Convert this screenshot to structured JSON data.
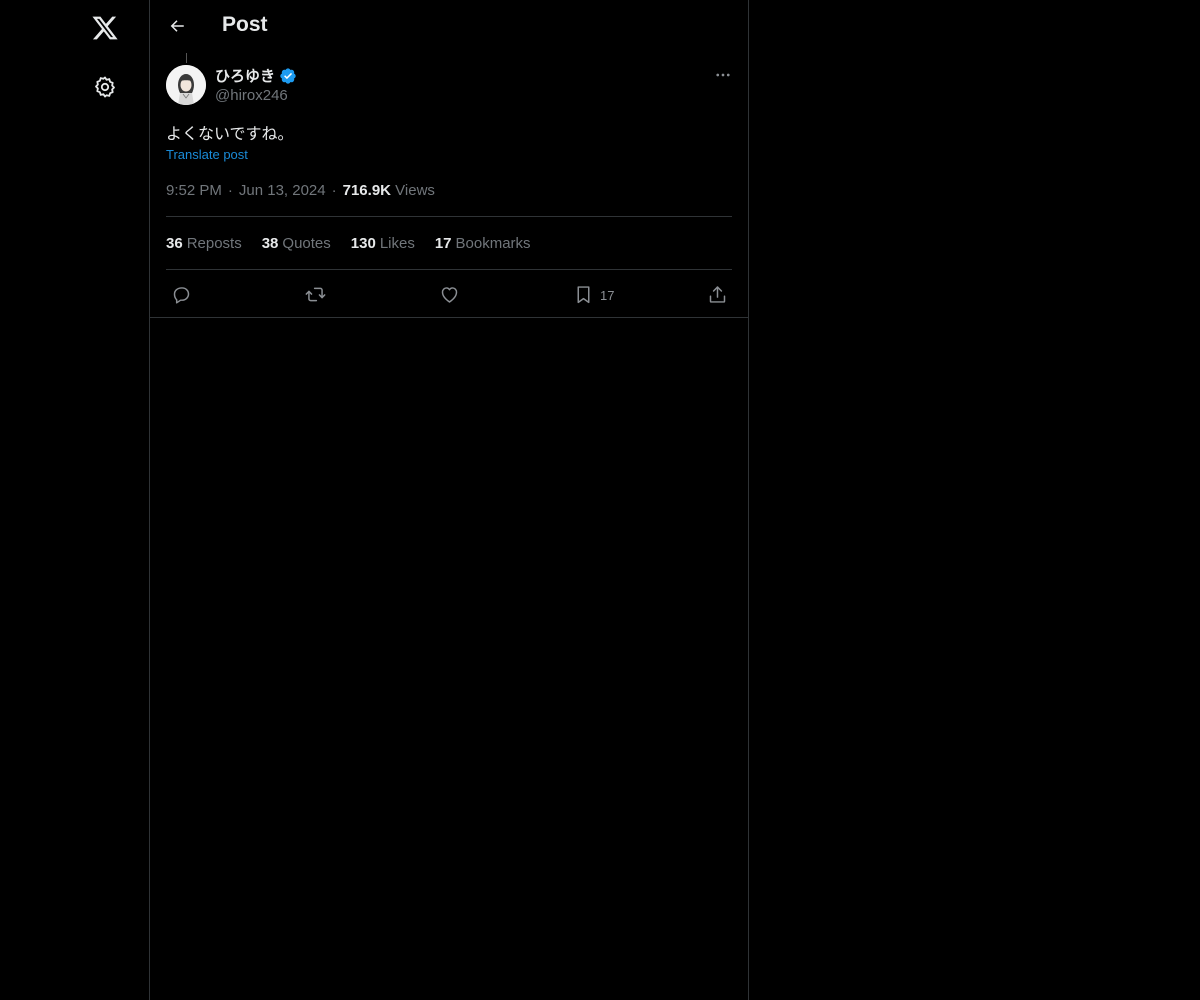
{
  "nav": {
    "logo_icon": "x-logo-icon",
    "settings_icon": "gear-icon"
  },
  "header": {
    "title": "Post",
    "back_icon": "arrow-left-icon"
  },
  "post": {
    "author_name": "ひろゆき",
    "verified_icon": "verified-badge-icon",
    "handle": "@hirox246",
    "text": "よくないですね。",
    "translate_label": "Translate post",
    "time": "9:52 PM",
    "date": "Jun 13, 2024",
    "views_count": "716.9K",
    "views_label": "Views"
  },
  "stats": {
    "reposts_count": "36",
    "reposts_label": "Reposts",
    "quotes_count": "38",
    "quotes_label": "Quotes",
    "likes_count": "130",
    "likes_label": "Likes",
    "bookmarks_count": "17",
    "bookmarks_label": "Bookmarks"
  },
  "actions": {
    "reply_icon": "reply-icon",
    "repost_icon": "repost-icon",
    "like_icon": "heart-icon",
    "bookmark_icon": "bookmark-icon",
    "bookmark_count": "17",
    "share_icon": "share-icon"
  },
  "colors": {
    "background": "#000000",
    "accent": "#1d9bf0",
    "text": "#e7e9ea",
    "muted": "#71767b",
    "border": "#2f3336"
  }
}
